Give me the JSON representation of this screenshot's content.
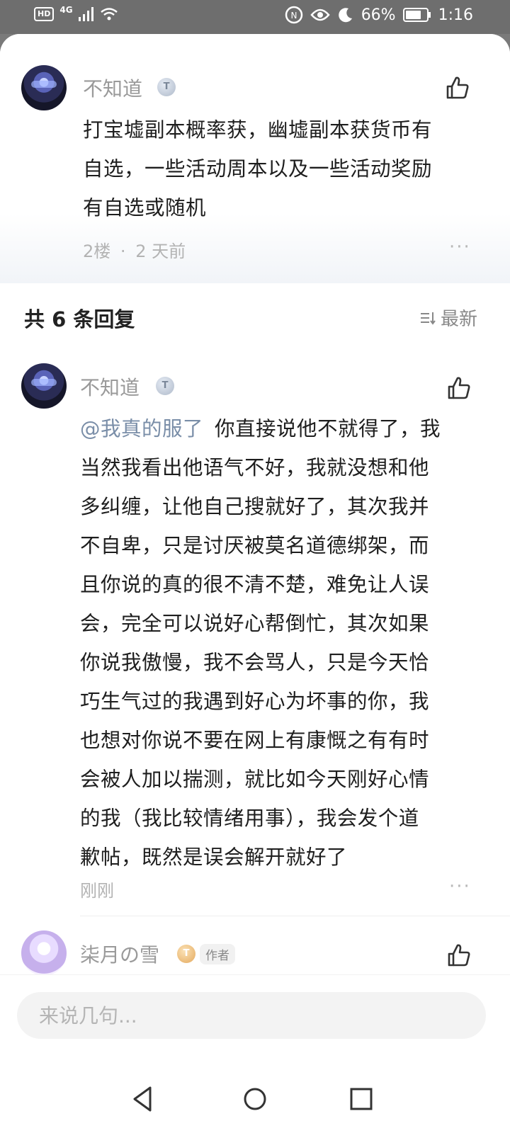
{
  "status_bar": {
    "hd": "HD",
    "network": "4G",
    "battery_percent": "66%",
    "time": "1:16",
    "icons": [
      "hd-icon",
      "signal-icon",
      "wifi-icon",
      "nfc-icon",
      "eye-icon",
      "moon-icon",
      "battery-icon"
    ]
  },
  "main_comment": {
    "username": "不知道",
    "level": "T",
    "text": "打宝墟副本概率获，幽墟副本获货币有自选，一些活动周本以及一些活动奖励有自选或随机",
    "lines": [
      "打宝墟副本概率获，幽墟副本获货币有",
      "自选，一些活动周本以及一些活动奖励",
      "有自选或随机"
    ],
    "floor": "2楼",
    "separator": "·",
    "time": "2 天前",
    "more": "···"
  },
  "replies_section": {
    "header": "共 6 条回复",
    "sort_label": "最新"
  },
  "replies": [
    {
      "username": "不知道",
      "level": "T",
      "mention": "@我真的服了",
      "lines": [
        "你直接说他不就得了，我",
        "当然我看出他语气不好，我就没想和他",
        "多纠缠，让他自己搜就好了，其次我并",
        "不自卑，只是讨厌被莫名道德绑架，而",
        "且你说的真的很不清不楚，难免让人误",
        "会，完全可以说好心帮倒忙，其次如果",
        "你说我傲慢，我不会骂人，只是今天恰",
        "巧生气过的我遇到好心为坏事的你，我",
        "也想对你说不要在网上有康慨之有有时",
        "会被人加以揣测，就比如今天刚好心情",
        "的我（我比较情绪用事），我会发个道",
        "歉帖，既然是误会解开就好了"
      ],
      "time": "刚刚",
      "more": "···"
    },
    {
      "username": "柒月の雪",
      "level": "T",
      "author_tag": "作者"
    }
  ],
  "input": {
    "placeholder": "来说几句..."
  },
  "nav": [
    "back-icon",
    "home-icon",
    "recents-icon"
  ]
}
